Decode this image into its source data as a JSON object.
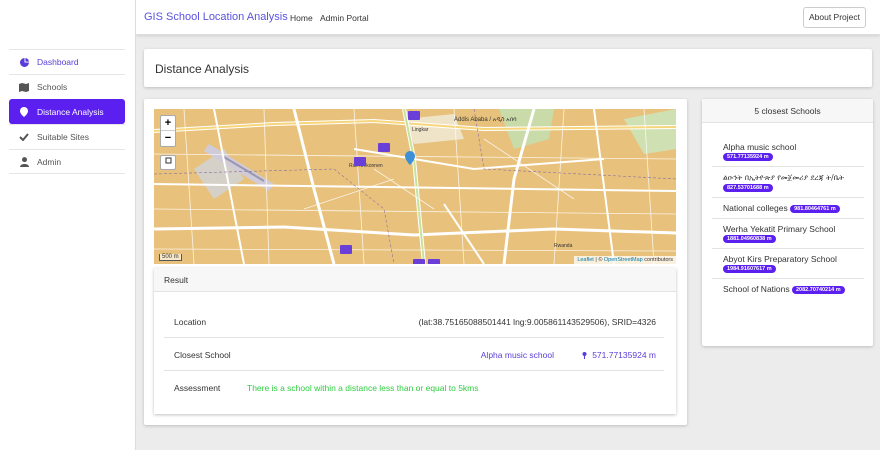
{
  "topnav": {
    "brand": "GIS School Location Analysis",
    "links": [
      "Home",
      "Admin Portal"
    ],
    "about_button": "About Project"
  },
  "sidebar": {
    "items": [
      {
        "label": "Dashboard",
        "icon": "pie-chart-icon"
      },
      {
        "label": "Schools",
        "icon": "map-icon"
      },
      {
        "label": "Distance Analysis",
        "icon": "map-pin-icon"
      },
      {
        "label": "Suitable Sites",
        "icon": "check-icon"
      },
      {
        "label": "Admin",
        "icon": "user-icon"
      }
    ],
    "active_index": 2
  },
  "page": {
    "title": "Distance Analysis"
  },
  "map": {
    "zoom_in": "+",
    "zoom_out": "−",
    "scale_label": "500 m",
    "attribution_prefix": "Leaflet",
    "attribution_sep": " | © ",
    "attribution_link": "OpenStreetMap",
    "attribution_suffix": " contributors",
    "place_labels": [
      "Addis Ababa / አዲስ አበባ",
      "Lingkar",
      "Ras Mekonnen",
      "Rwanda"
    ]
  },
  "result": {
    "header": "Result",
    "location_label": "Location",
    "location_value": "(lat:38.75165088501441 lng:9.005861143529506), SRID=4326",
    "closest_label": "Closest School",
    "closest_name": "Alpha music school",
    "closest_distance": "571.77135924 m",
    "assessment_label": "Assessment",
    "assessment_value": "There is a school within a distance less than or equal to 5kms"
  },
  "closest": {
    "header": "5 closest Schools",
    "schools": [
      {
        "name": "Alpha music school",
        "distance": "571.77135924 m"
      },
      {
        "name": "ልዑንት በኢትዮጵያ የመጀመሪያ ደረጃ ት/ቤት",
        "distance": "827.53701688 m"
      },
      {
        "name": "National colleges",
        "distance": "981.80464761 m"
      },
      {
        "name": "Werha Yekatit Primary School",
        "distance": "1881.04960838 m"
      },
      {
        "name": "Abyot Kirs Preparatory School",
        "distance": "1984.91607617 m"
      },
      {
        "name": "School of Nations",
        "distance": "2082.70740214 m"
      }
    ]
  },
  "colors": {
    "accent": "#5b1ff0",
    "brand": "#5a52e0",
    "success": "#2ecc40",
    "map_land": "#e8c27c"
  }
}
